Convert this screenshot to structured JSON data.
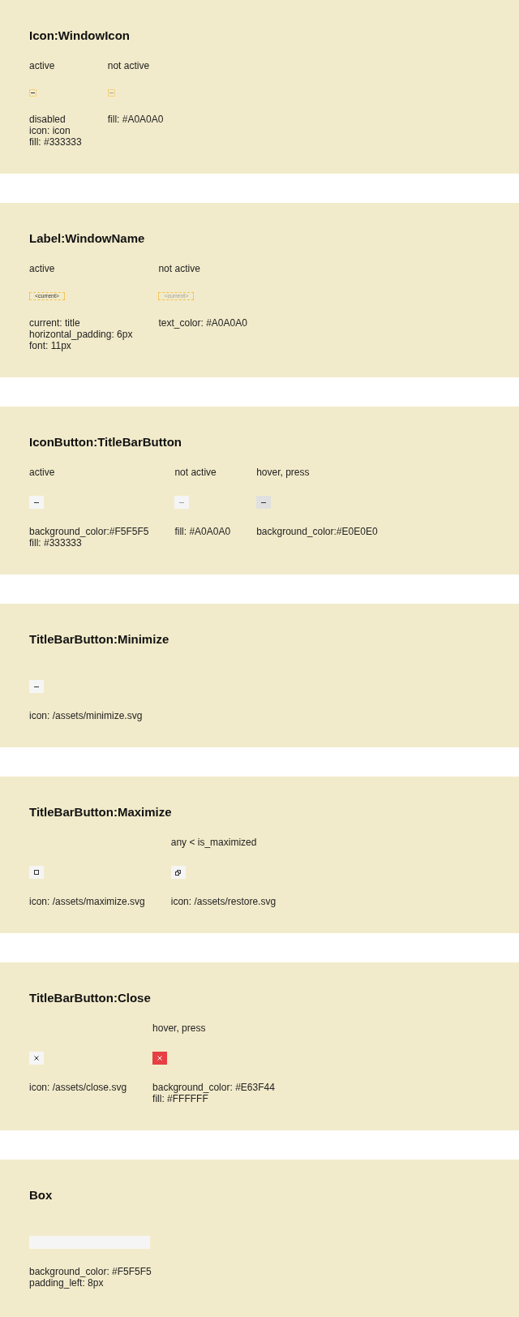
{
  "sections": [
    {
      "title": "Icon:WindowIcon",
      "variants": [
        {
          "kind": "window_icon",
          "state": "active",
          "active": true,
          "description": [
            "disabled",
            "icon: icon",
            "fill: #333333"
          ]
        },
        {
          "kind": "window_icon",
          "state": "not active",
          "active": false,
          "description": [
            "fill: #A0A0A0"
          ]
        }
      ]
    },
    {
      "title": "Label:WindowName",
      "variants": [
        {
          "kind": "window_name",
          "state": "active",
          "text": "<current>",
          "active": true,
          "description": [
            "current: title",
            "horizontal_padding: 6px",
            "font: 11px"
          ]
        },
        {
          "kind": "window_name",
          "state": "not active",
          "text": "<current>",
          "active": false,
          "description": [
            "text_color: #A0A0A0"
          ]
        }
      ]
    },
    {
      "title": "IconButton:TitleBarButton",
      "variants": [
        {
          "kind": "minimize",
          "state": "active",
          "active": true,
          "hovered": false,
          "description": [
            "background_color:#F5F5F5",
            "fill: #333333"
          ]
        },
        {
          "kind": "minimize",
          "state": "not active",
          "active": false,
          "hovered": false,
          "description": [
            "fill: #A0A0A0"
          ]
        },
        {
          "kind": "minimize",
          "state": "hover, press",
          "active": true,
          "hovered": true,
          "description": [
            "background_color:#E0E0E0"
          ]
        }
      ]
    },
    {
      "title": "TitleBarButton:Minimize",
      "variants": [
        {
          "kind": "minimize",
          "active": true,
          "hovered": false,
          "description": [
            "icon: /assets/minimize.svg"
          ]
        }
      ]
    },
    {
      "title": "TitleBarButton:Maximize",
      "variants": [
        {
          "kind": "maximize",
          "active": true,
          "hovered": false,
          "description": [
            "icon: /assets/maximize.svg"
          ]
        },
        {
          "kind": "restore",
          "state": "any < is_maximized",
          "active": true,
          "hovered": false,
          "description": [
            "icon: /assets/restore.svg"
          ]
        }
      ]
    },
    {
      "title": "TitleBarButton:Close",
      "variants": [
        {
          "kind": "close",
          "active": true,
          "hovered": false,
          "description": [
            "icon: /assets/close.svg"
          ]
        },
        {
          "kind": "close",
          "state": "hover, press",
          "active": true,
          "hovered": true,
          "description": [
            "background_color: #E63F44",
            "fill: #FFFFFF"
          ]
        }
      ]
    },
    {
      "title": "Box",
      "variants": [
        {
          "kind": "box",
          "description": [
            "background_color: #F5F5F5",
            "padding_left: 8px"
          ]
        }
      ]
    }
  ]
}
